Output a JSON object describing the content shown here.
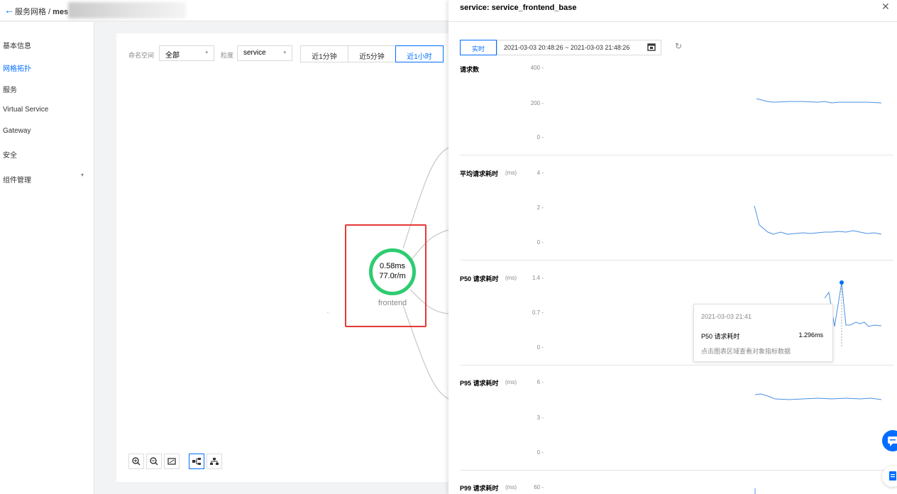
{
  "header": {
    "back_arrow": "←",
    "breadcrumb_parent": "服务网格 / ",
    "breadcrumb_current": "mes"
  },
  "sidebar": {
    "items": [
      {
        "label": "基本信息"
      },
      {
        "label": "网格拓扑"
      },
      {
        "label": "服务"
      },
      {
        "label": "Virtual Service"
      },
      {
        "label": "Gateway"
      },
      {
        "label": "安全"
      },
      {
        "label": "组件管理"
      }
    ],
    "caret": "▾"
  },
  "filters": {
    "namespace_label": "命名空间",
    "namespace_value": "全部",
    "granularity_label": "粒度",
    "granularity_value": "service",
    "time_buttons": [
      "近1分钟",
      "近5分钟",
      "近1小时"
    ],
    "caret": "▾"
  },
  "topology": {
    "node_latency": "0.58ms",
    "node_rate": "77.0r/m",
    "node_name": "frontend"
  },
  "drawer": {
    "title": "service: service_frontend_base",
    "close": "✕",
    "realtime_label": "实时",
    "range": "2021-03-03 20:48:26 ~ 2021-03-03 21:48:26",
    "refresh": "↻",
    "metrics": [
      {
        "title": "请求数",
        "unit": "",
        "ticks": [
          "400 -",
          "200 -",
          "0 -"
        ]
      },
      {
        "title": "平均请求耗时",
        "unit": "(ms)",
        "ticks": [
          "4 -",
          "2 -",
          "0 -"
        ]
      },
      {
        "title": "P50 请求耗时",
        "unit": "(ms)",
        "ticks": [
          "1.4 -",
          "0.7 -",
          "0 -"
        ]
      },
      {
        "title": "P95 请求耗时",
        "unit": "(ms)",
        "ticks": [
          "6 -",
          "3 -",
          "0 -"
        ]
      },
      {
        "title": "P99 请求耗时",
        "unit": "(ms)",
        "ticks": [
          "60 -"
        ]
      }
    ],
    "tooltip": {
      "time": "2021-03-03 21:41",
      "name": "P50 请求耗时",
      "value": "1.296ms",
      "hint": "点击图表区域查看对象指标数据"
    }
  },
  "colors": {
    "accent": "#006eff",
    "node_ring": "#2ecc71",
    "highlight": "#e53935",
    "line": "#4a90e2"
  }
}
